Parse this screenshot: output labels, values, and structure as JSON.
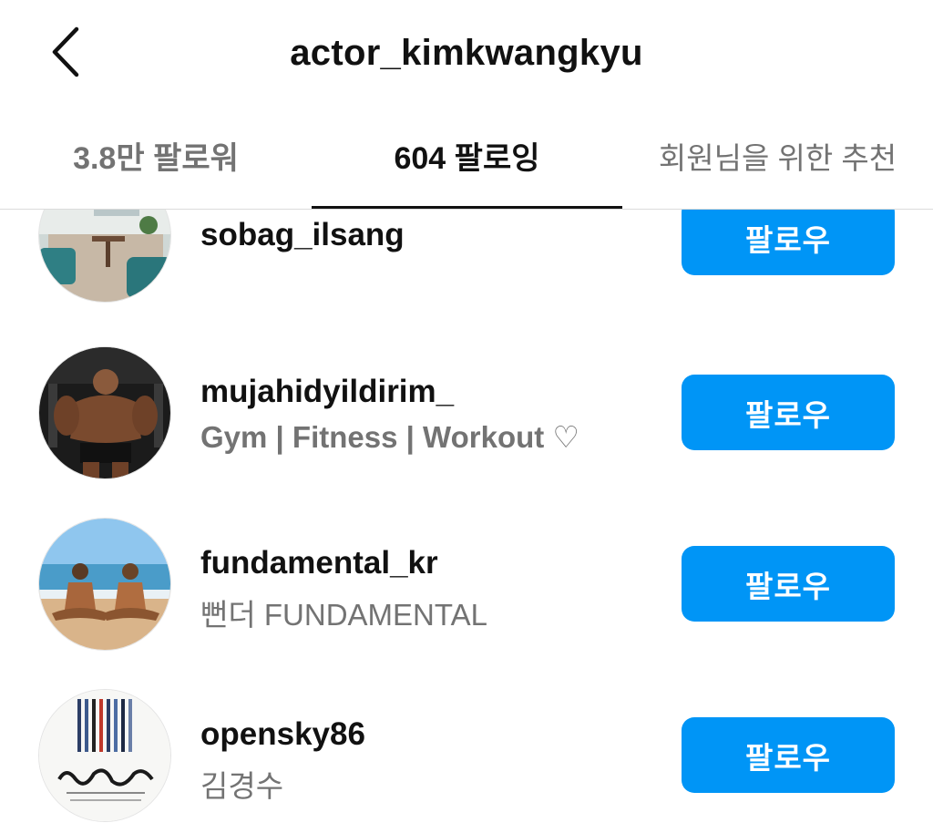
{
  "header": {
    "title": "actor_kimkwangkyu"
  },
  "tabs": [
    {
      "label": "3.8만 팔로워"
    },
    {
      "label": "604 팔로잉"
    },
    {
      "label": "회원님을 위한 추천"
    }
  ],
  "following": [
    {
      "username": "sobag_ilsang",
      "subtitle": "",
      "button": "팔로우",
      "avatar": "cafe-interior"
    },
    {
      "username": "mujahidyildirim_",
      "subtitle": "Gym | Fitness | Workout ♡",
      "button": "팔로우",
      "avatar": "bodybuilder"
    },
    {
      "username": "fundamental_kr",
      "subtitle": "뻔더 FUNDAMENTAL",
      "button": "팔로우",
      "avatar": "beach-meditation"
    },
    {
      "username": "opensky86",
      "subtitle": "김경수",
      "button": "팔로우",
      "avatar": "book-cover"
    }
  ],
  "colors": {
    "follow_button": "#0095f6",
    "secondary_text": "#737373"
  }
}
